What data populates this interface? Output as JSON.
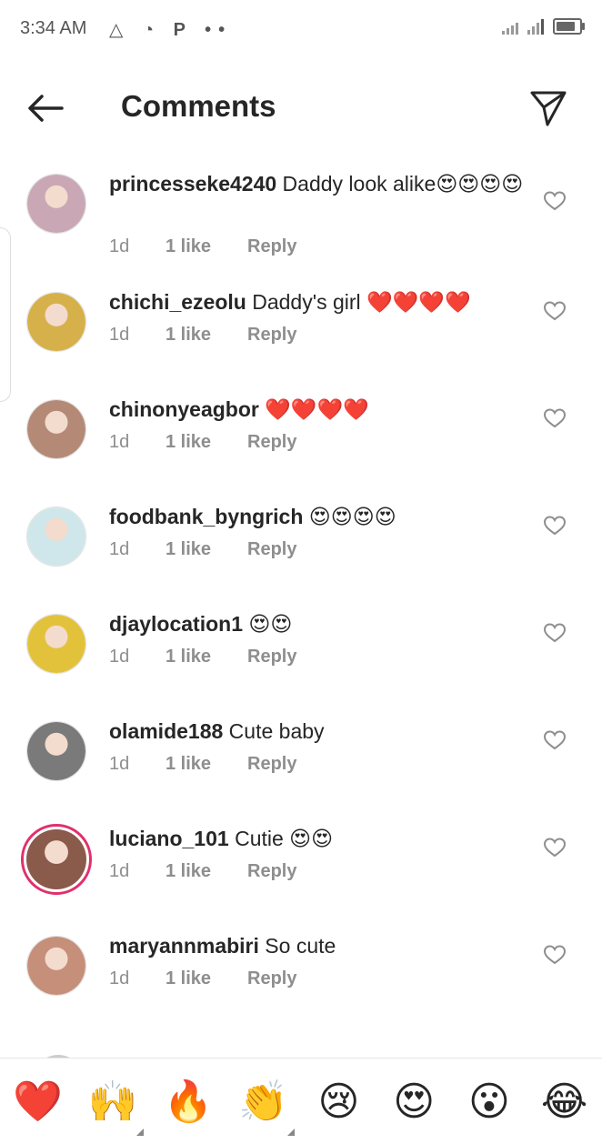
{
  "status_bar": {
    "time": "3:34 AM",
    "left_icons": "△ ◔ P ••"
  },
  "header": {
    "title": "Comments",
    "back_icon": "arrow-left-icon",
    "send_icon": "paper-plane-icon"
  },
  "comments": [
    {
      "username": "princesseke4240",
      "text": " Daddy look alike",
      "emojis": "😍😍😍😍",
      "time": "1d",
      "likes": "1 like",
      "reply": "Reply",
      "avatar_color": "#c9a7b5",
      "story_ring": false
    },
    {
      "username": "chichi_ezeolu",
      "text": " Daddy's girl ",
      "emojis": "❤️❤️❤️❤️",
      "time": "1d",
      "likes": "1 like",
      "reply": "Reply",
      "avatar_color": "#d6b04a",
      "story_ring": false
    },
    {
      "username": "chinonyeagbor",
      "text": " ",
      "emojis": "❤️❤️❤️❤️",
      "time": "1d",
      "likes": "1 like",
      "reply": "Reply",
      "avatar_color": "#b48a77",
      "story_ring": false
    },
    {
      "username": "foodbank_byngrich",
      "text": " ",
      "emojis": "😍😍😍😍",
      "time": "1d",
      "likes": "1 like",
      "reply": "Reply",
      "avatar_color": "#cfe7ea",
      "story_ring": false
    },
    {
      "username": "djaylocation1",
      "text": " ",
      "emojis": "😍😍",
      "time": "1d",
      "likes": "1 like",
      "reply": "Reply",
      "avatar_color": "#e3c23b",
      "story_ring": false
    },
    {
      "username": "olamide188",
      "text": " Cute baby",
      "emojis": "",
      "time": "1d",
      "likes": "1 like",
      "reply": "Reply",
      "avatar_color": "#7a7a7a",
      "story_ring": false
    },
    {
      "username": "luciano_101",
      "text": " Cutie ",
      "emojis": "😍😍",
      "time": "1d",
      "likes": "1 like",
      "reply": "Reply",
      "avatar_color": "#8a5a4b",
      "story_ring": true
    },
    {
      "username": "maryannmabiri",
      "text": " So cute",
      "emojis": "",
      "time": "1d",
      "likes": "1 like",
      "reply": "Reply",
      "avatar_color": "#c58f7a",
      "story_ring": false
    }
  ],
  "emoji_bar": [
    {
      "emoji": "❤️",
      "name": "red-heart-emoji-button"
    },
    {
      "emoji": "🙌",
      "name": "raised-hands-emoji-button"
    },
    {
      "emoji": "🔥",
      "name": "fire-emoji-button"
    },
    {
      "emoji": "👏",
      "name": "clapping-hands-emoji-button"
    },
    {
      "emoji": "😢",
      "name": "crying-face-emoji-button"
    },
    {
      "emoji": "😍",
      "name": "heart-eyes-emoji-button"
    },
    {
      "emoji": "😮",
      "name": "surprised-face-emoji-button"
    },
    {
      "emoji": "😂",
      "name": "tears-of-joy-emoji-button"
    }
  ],
  "colors": {
    "text": "#262626",
    "secondary": "#8e8e8e",
    "story_ring": "#e1306c"
  }
}
